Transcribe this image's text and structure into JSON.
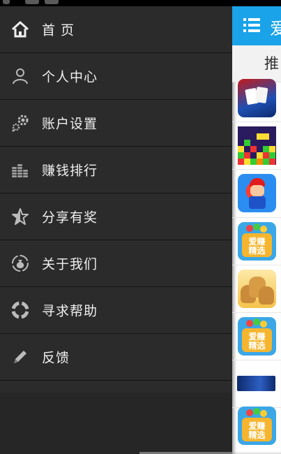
{
  "drawer": {
    "items": [
      {
        "label": "首 页",
        "icon": "home-icon"
      },
      {
        "label": "个人中心",
        "icon": "user-icon"
      },
      {
        "label": "账户设置",
        "icon": "gear-icon"
      },
      {
        "label": "赚钱排行",
        "icon": "coins-stack-icon"
      },
      {
        "label": "分享有奖",
        "icon": "star-icon"
      },
      {
        "label": "关于我们",
        "icon": "money-bag-icon"
      },
      {
        "label": "寻求帮助",
        "icon": "lifebuoy-icon"
      },
      {
        "label": "反馈",
        "icon": "pencil-icon"
      }
    ]
  },
  "main": {
    "title": "爱",
    "tab": "推",
    "apps": [
      {
        "icon": "poker-app-icon"
      },
      {
        "icon": "tetris-app-icon"
      },
      {
        "icon": "mario-app-icon"
      },
      {
        "icon": "aizhuan-jingxuan-icon",
        "badge_line1": "爱赚",
        "badge_line2": "精选"
      },
      {
        "icon": "money-bags-app-icon"
      },
      {
        "icon": "aizhuan-jingxuan-icon",
        "badge_line1": "爱赚",
        "badge_line2": "精选"
      },
      {
        "icon": "banner-ad-icon"
      },
      {
        "icon": "aizhuan-jingxuan-icon",
        "badge_line1": "爱赚",
        "badge_line2": "精选"
      }
    ]
  },
  "colors": {
    "accent": "#1aa3e8",
    "drawer_bg": "#2b2b2b"
  }
}
